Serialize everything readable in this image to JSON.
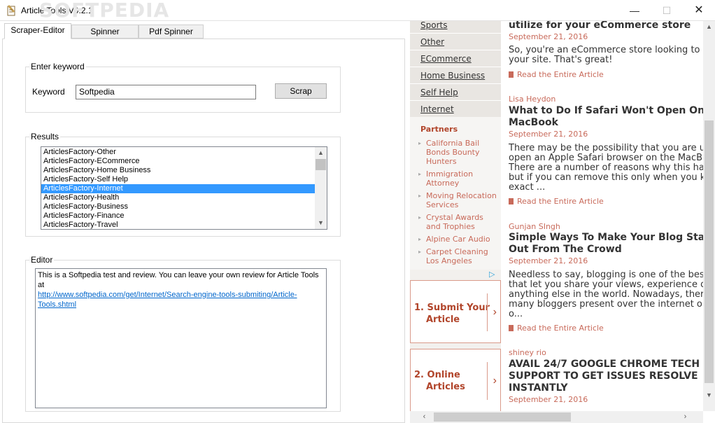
{
  "window": {
    "title": "Article Tools V0.2.1",
    "minimize": "—",
    "maximize": "☐",
    "close": "✕"
  },
  "watermark": "SOFTPEDIA",
  "tabs": [
    {
      "label": "Scraper-Editor",
      "active": true
    },
    {
      "label": "Spinner",
      "active": false
    },
    {
      "label": "Pdf Spinner",
      "active": false
    }
  ],
  "keyword_group": {
    "title": "Enter keyword",
    "label": "Keyword",
    "value": "Softpedia",
    "button": "Scrap"
  },
  "results_group": {
    "title": "Results",
    "items": [
      "ArticlesFactory-Other",
      "ArticlesFactory-ECommerce",
      "ArticlesFactory-Home Business",
      "ArticlesFactory-Self Help",
      "ArticlesFactory-Internet",
      "ArticlesFactory-Health",
      "ArticlesFactory-Business",
      "ArticlesFactory-Finance",
      "ArticlesFactory-Travel"
    ],
    "selected_index": 4
  },
  "editor_group": {
    "title": "Editor",
    "text": "This is a Softpedia test and review. You can leave your own review for Article Tools at ",
    "link_line1": "http://www.softpedia.com/get/Internet/Search-engine-tools-submiting/Article-",
    "link_line2": "Tools.shtml"
  },
  "browser": {
    "categories": [
      "Sports",
      "Other",
      "ECommerce",
      "Home Business",
      "Self Help",
      "Internet"
    ],
    "partners_title": "Partners",
    "partners": [
      {
        "l1": "California Bail",
        "l2": "Bonds Bounty",
        "l3": "Hunters"
      },
      {
        "l1": "Immigration",
        "l2": "Attorney",
        "l3": ""
      },
      {
        "l1": "Moving Relocation",
        "l2": "Services",
        "l3": ""
      },
      {
        "l1": "Crystal Awards",
        "l2": "and Trophies",
        "l3": ""
      },
      {
        "l1": "Alpine Car Audio",
        "l2": "",
        "l3": ""
      },
      {
        "l1": "Carpet Cleaning",
        "l2": "Los Angeles",
        "l3": ""
      }
    ],
    "ads": [
      {
        "num": "1.",
        "l1": "Submit Your",
        "l2": "Article"
      },
      {
        "num": "2.",
        "l1": "Online",
        "l2": "Articles"
      }
    ],
    "articles": [
      {
        "author": "",
        "title1": "utilize for your eCommerce store",
        "title2": "",
        "date": "September 21, 2016",
        "ex1": "So, you're an eCommerce store looking to sp",
        "ex2": "your site. That's great!",
        "ex3": "",
        "ex4": "",
        "ex5": "",
        "read": "Read the Entire Article"
      },
      {
        "author": "Lisa Heydon",
        "title1": "What to Do If Safari Won't Open On",
        "title2": "MacBook",
        "date": "September 21, 2016",
        "ex1": "There may be the possibility that you are un",
        "ex2": "open an Apple Safari browser on the MacBo",
        "ex3": "There are a number of reasons why this hap",
        "ex4": "but if you can remove this only when you kn",
        "ex5": "exact ...",
        "read": "Read the Entire Article"
      },
      {
        "author": "Gunjan SIngh",
        "title1": "Simple Ways To Make Your Blog Sta",
        "title2": "Out From The Crowd",
        "date": "September 21, 2016",
        "ex1": "Needless to say, blogging is one of the best",
        "ex2": "that let you share your views, experience or",
        "ex3": "anything else in the world. Nowadays, there",
        "ex4": "many bloggers present over the internet or",
        "ex5": "o...",
        "read": "Read the Entire Article"
      },
      {
        "author": "shiney rio",
        "title1": "AVAIL 24/7 GOOGLE CHROME TECH",
        "title2": "SUPPORT TO GET ISSUES RESOLVE",
        "title3": "INSTANTLY",
        "date": "September 21, 2016"
      }
    ]
  }
}
